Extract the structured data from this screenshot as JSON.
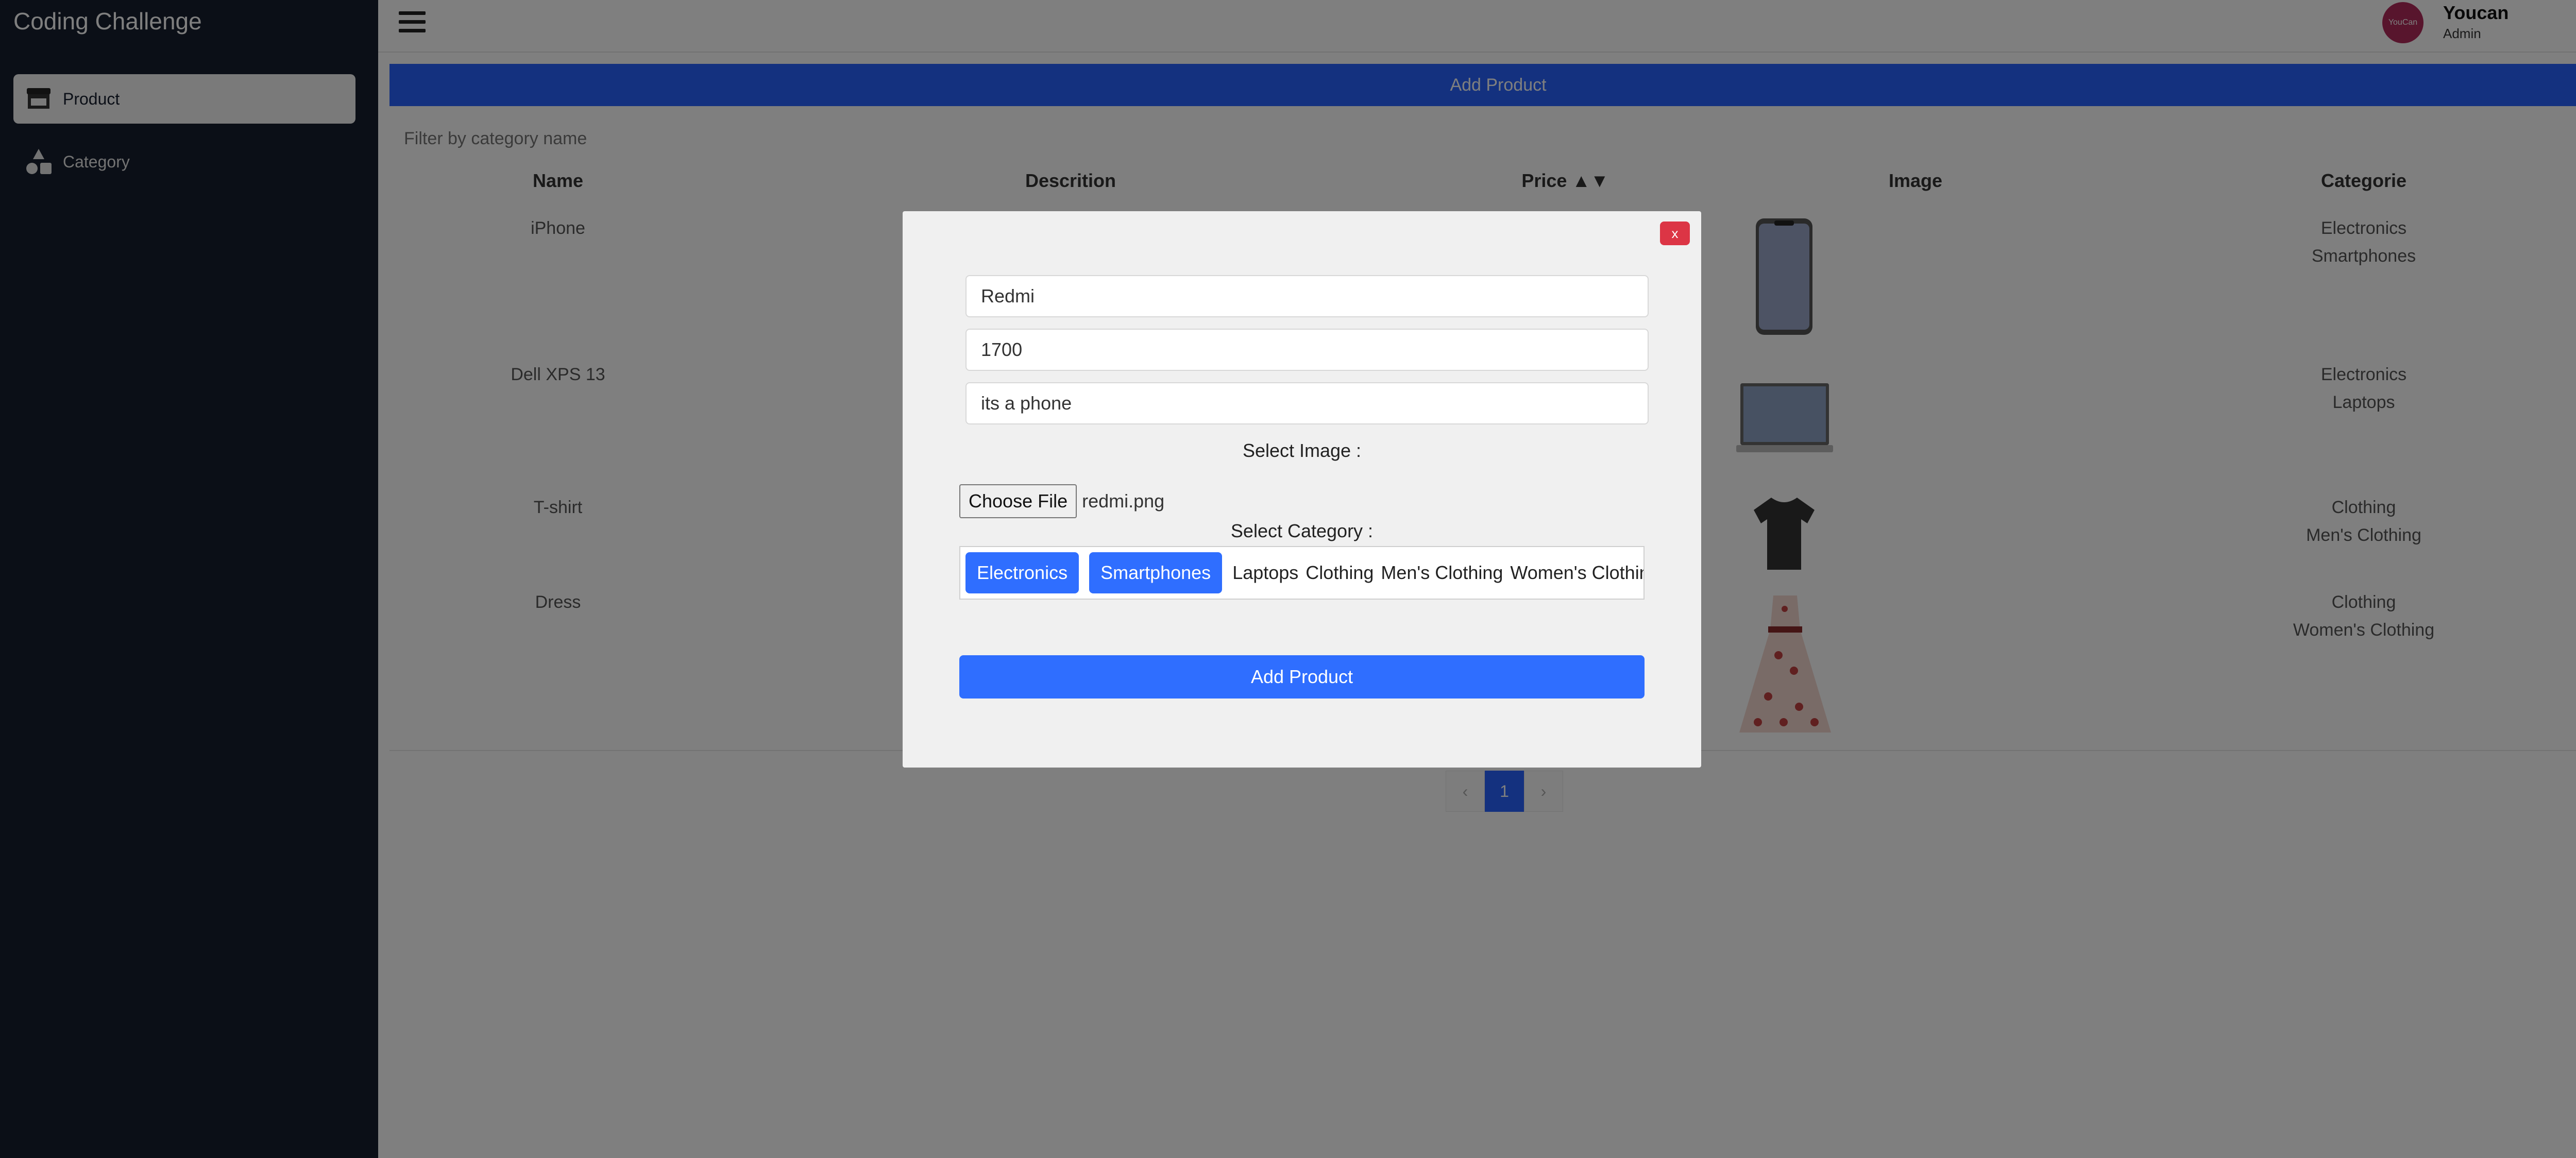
{
  "app": {
    "title": "Coding Challenge"
  },
  "sidebar": {
    "items": [
      {
        "label": "Product",
        "icon": "store-icon",
        "active": true
      },
      {
        "label": "Category",
        "icon": "shapes-icon",
        "active": false
      }
    ]
  },
  "header": {
    "menu_icon": "hamburger-icon",
    "avatar_text": "YouCan",
    "user_name": "Youcan",
    "user_role": "Admin"
  },
  "main": {
    "add_button": "Add Product",
    "filter_placeholder": "Filter by category name",
    "columns": [
      "Name",
      "Descrition",
      "Price ▲▼",
      "Image",
      "Categorie"
    ],
    "rows": [
      {
        "name": "iPhone",
        "image": "iphone-image",
        "categories": [
          "Electronics",
          "Smartphones"
        ]
      },
      {
        "name": "Dell XPS 13",
        "image": "laptop-image",
        "categories": [
          "Electronics",
          "Laptops"
        ]
      },
      {
        "name": "T-shirt",
        "image": "tshirt-image",
        "categories": [
          "Clothing",
          "Men's Clothing"
        ]
      },
      {
        "name": "Dress",
        "image": "dress-image",
        "categories": [
          "Clothing",
          "Women's Clothing"
        ]
      }
    ],
    "pagination": {
      "prev": "‹",
      "current": "1",
      "next": "›"
    }
  },
  "modal": {
    "close_label": "x",
    "name_value": "Redmi",
    "price_value": "1700",
    "description_value": "its a phone",
    "select_image_label": "Select Image :",
    "choose_file_label": "Choose File",
    "file_name": "redmi.png",
    "select_category_label": "Select Category :",
    "selected_categories": [
      "Electronics",
      "Smartphones"
    ],
    "available_categories": [
      "Laptops",
      "Clothing",
      "Men's Clothing",
      "Women's Clothing"
    ],
    "submit_label": "Add Product"
  },
  "colors": {
    "sidebar_bg": "#161e2e",
    "primary": "#2962ff",
    "chip": "#2f6eff",
    "danger": "#dc3545",
    "avatar": "#b02a5b"
  }
}
